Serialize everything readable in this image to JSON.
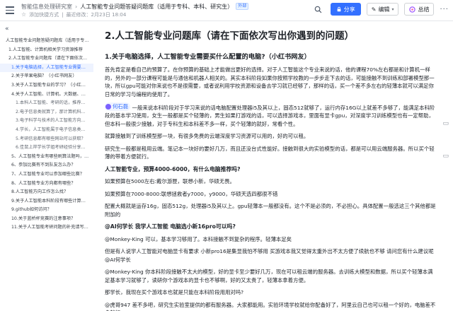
{
  "header": {
    "space_name": "智能信息处理研究室",
    "doc_title": "人工智能专业问题答疑问题库（适用于专科、本科、研究生）",
    "badge": "外部",
    "star": "☆",
    "shortcut_label": "添加快捷方式",
    "updated": "最近修改：2月23日 18:04",
    "share_label": "分享",
    "edit_label": "编辑",
    "summary_label": "总结",
    "colors": {
      "accent": "#3370ff"
    }
  },
  "sidebar": {
    "collapse": "«",
    "items": [
      {
        "label": "人工智能专业问题答疑问题库（适用于专…",
        "level": "l1"
      },
      {
        "label": "1.人工智能、计算机相关学习资源推荐",
        "level": "l2"
      },
      {
        "label": "2.人工智能专业问题库（请在下面依次写…",
        "level": "l2"
      },
      {
        "label": "1.关于电脑选择，人工智能专业需要…",
        "level": "l3",
        "active": true
      },
      {
        "label": "2.关于苹果电脑？（小红书网友）",
        "level": "l3"
      },
      {
        "label": "3.关于人工智能专业的学习？（小红…",
        "level": "l3"
      },
      {
        "label": "4.关于人工智能、计算机、大数据、…",
        "level": "l3"
      },
      {
        "label": "1.本科人工智能、考研的话，推荐…",
        "level": "l4"
      },
      {
        "label": "2.电子信息类就算了，那计算机科…",
        "level": "l4"
      },
      {
        "label": "3.电子科学与技术的人工智能方向…",
        "level": "l4"
      },
      {
        "label": "4.学长，人工智能属于电子信息类…",
        "level": "l4"
      },
      {
        "label": "5.考研信息都有哪些网站可以获取？",
        "level": "l4"
      },
      {
        "label": "6.佳鼠上岸学长学姐考研经验分享…",
        "level": "l4"
      },
      {
        "label": "5、人工智能专业有哪些刷算法题吗，如…",
        "level": "l3"
      },
      {
        "label": "6、参加比赛有不到队友怎么办？",
        "level": "l3"
      },
      {
        "label": "7、人工智能专业可以参加哪些比赛？",
        "level": "l3"
      },
      {
        "label": "8、人工智能专业方向都有哪些？",
        "level": "l3"
      },
      {
        "label": "8.人工智能方向工作怎么找？",
        "level": "l3"
      },
      {
        "label": "9.关于人工智能本科阶段有哪些计算…",
        "level": "l3"
      },
      {
        "label": "9.github如何访问？",
        "level": "l3"
      },
      {
        "label": "10.关于蓝桥杯竞赛的注意事项？",
        "level": "l3"
      },
      {
        "label": "11.关于人工智能考研问题的补充请写…",
        "level": "l3"
      }
    ]
  },
  "content": {
    "title": "2.人工智能专业问题库（请在下面依次写出你遇到的问题）",
    "subtitle": "1.关于电脑选择，人工智能专业需要买什么配置的电脑?（小红书网友）",
    "p1": "首先肯定是看自己的预算了。在你预算的基础上才能做出更好的选择。对于人工智能这个专业来说的话，他的课程70%左右都是和计算机一样的，另外的一部分课程可能是与通信和机器人相关的。其实本科阶段如果你按照学校教的一步步走下去的话，可能接触不到训练和部署模型那一块，所以gpu可能对你来说也不是很需要，或者说利用学校资源和设备去学习就已经够了，那样的话，买一个差不多左右的轻薄本就可以满足你日常的学习与编程的使用了。",
    "p2_mention": "何石磊",
    "p2": "一般来说本科阶段对于学习来说的话电脑配置处理器i5及其以上，固态512就够了，运行内存16G以上就差不多够了，能满足本科阶段的基本学习使用，女生一般都是买个轻薄的，男生如果打游戏的话，可以选择游戏本，里面有显卡gpu，对深度学习训练模型也有一定帮助，但本科一般很少接触，对于专科生和本科差不多一样，买个轻薄的就好，常看个性。",
    "p3": "就算接触到了训练模型那一块，有很多免费的云端深度学习资源可以用的，好的可以租。",
    "p4": "研究生一般都是租用云端。笔记本一块好的要好几万，而且还没台式性能好。接触到很大的实验模型的话，都是可以用云端服务器。所以买个轻薄的带着方便就行。",
    "q1": "人工智能专业，预算4000-6000，有什么电脑推荐吗?",
    "a1": "如果预算在5000左右:戴尔游匣，联想小新，华硕无畏。",
    "a2": "如果预算在7000-8000:联想拯救者y7000，y9000，华硕天选四都很不错",
    "a3": "配置大概就是运存16g，固态512g，处理器i5及其以上。gpu轻薄本一般都没有。这个不是必须的，不必担心。具体配置一般选这三个其他都是附加的",
    "q2": "@AI何学长 我学人工智能 电脑选小新16pro可以吗?",
    "a4": "@Monkey-King 可以，基本学习够用了。本科接触不到复杂的程序。轻薄本足矣",
    "a5": "但是有人说学人工智能对电脑显卡有要求 小新pro16是集显我怕不够用 买游戏本我又觉得太重外出不太方便了续航也不够  请问您有什么建议呢@AI何学长",
    "a6": "@Monkey-King 你本科阶段接触不太大的模型，好的显卡至少要好几万，现在可以租云端的服务器。去训练大模型和数据，所以买个轻薄本满足基本学习就够了，读研你个游戏本的显卡也不够啊，好的又太贵了，轻薄本拿着方便。",
    "a7": "那学长，我现在买个游戏本也就是只能在本科阶段用用对吗?",
    "a8": "@虎哥947 差不多吧，研究生实验室提供的都有服务器。大家都能用。实验环境学校就给你配备好了，阿里云自己也可以租一个好的，电脑差不多就行。"
  }
}
